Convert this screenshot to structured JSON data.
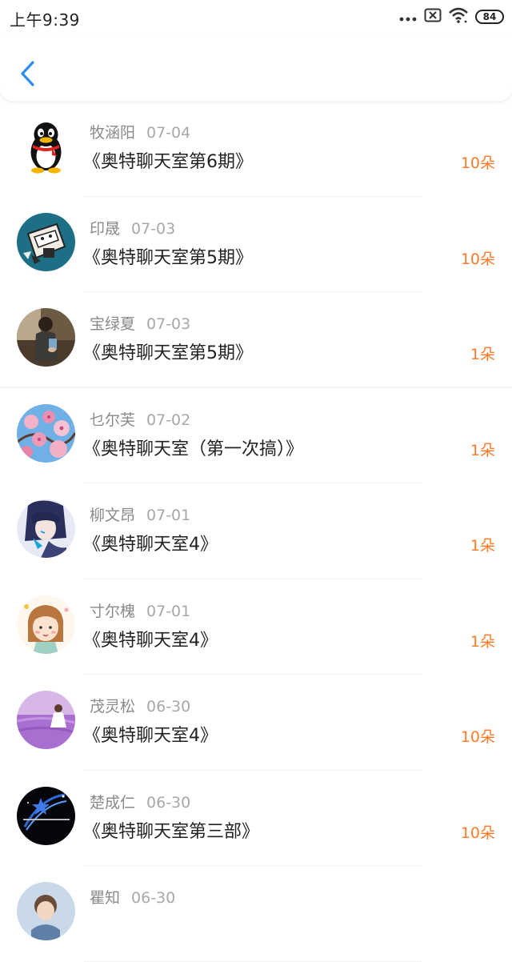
{
  "status_bar": {
    "time": "上午9:39",
    "battery": "84"
  },
  "header": {
    "back_icon": "chevron-left-icon",
    "accent_color": "#2c8df0"
  },
  "rows": [
    {
      "name": "牧涵阳",
      "date": "07-04",
      "title": "《奥特聊天室第6期》",
      "flowers": "10朵",
      "avatar": "qq-penguin"
    },
    {
      "name": "印晟",
      "date": "07-03",
      "title": "《奥特聊天室第5期》",
      "flowers": "10朵",
      "avatar": "cartoon-box"
    },
    {
      "name": "宝绿夏",
      "date": "07-03",
      "title": "《奥特聊天室第5期》",
      "flowers": "1朵",
      "avatar": "photo-person"
    },
    {
      "name": "乜尔芙",
      "date": "07-02",
      "title": "《奥特聊天室（第一次搞）》",
      "flowers": "1朵",
      "avatar": "pink-blossoms"
    },
    {
      "name": "柳文昂",
      "date": "07-01",
      "title": "《奥特聊天室4》",
      "flowers": "1朵",
      "avatar": "anime-girl"
    },
    {
      "name": "寸尔槐",
      "date": "07-01",
      "title": "《奥特聊天室4》",
      "flowers": "1朵",
      "avatar": "cartoon-girl"
    },
    {
      "name": "茂灵松",
      "date": "06-30",
      "title": "《奥特聊天室4》",
      "flowers": "10朵",
      "avatar": "lavender-field"
    },
    {
      "name": "楚成仁",
      "date": "06-30",
      "title": "《奥特聊天室第三部》",
      "flowers": "10朵",
      "avatar": "star-night"
    },
    {
      "name": "瞿知",
      "date": "06-30",
      "title": "",
      "flowers": "",
      "avatar": "partial-photo"
    }
  ],
  "colors": {
    "flowers": "#ff7a29",
    "name": "#8a8a8a",
    "date": "#a8a8a8",
    "title": "#222222"
  }
}
